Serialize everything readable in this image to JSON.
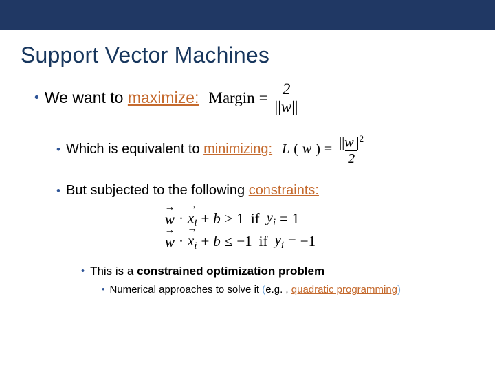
{
  "title": "Support Vector Machines",
  "line1": {
    "pre": "We want to ",
    "kw": "maximize:",
    "post": ""
  },
  "margin_eq": {
    "lhs": "Margin",
    "eq": "=",
    "num": "2",
    "den_l": "||",
    "den_w": "w",
    "den_r": "||"
  },
  "line2": {
    "pre": "Which is equivalent to ",
    "kw": "minimizing:"
  },
  "loss_eq": {
    "L": "L",
    "lp": "(",
    "w": "w",
    "rp": ")",
    "eq": "=",
    "num_l": "||",
    "num_w": "w",
    "num_r": "||",
    "sq": "2",
    "den": "2"
  },
  "line3": {
    "pre": "But subjected to the following ",
    "kw": "constraints:"
  },
  "constraints": [
    {
      "w": "w",
      "dot": "·",
      "xi": "x",
      "sub": "i",
      "plus": "+",
      "b": "b",
      "op": "≥",
      "one": "1",
      "if": "if",
      "yi": "y",
      "ysub": "i",
      "eq": "=",
      "val": "1"
    },
    {
      "w": "w",
      "dot": "·",
      "xi": "x",
      "sub": "i",
      "plus": "+",
      "b": "b",
      "op": "≤",
      "one": "−1",
      "if": "if",
      "yi": "y",
      "ysub": "i",
      "eq": "=",
      "val": "−1"
    }
  ],
  "line4": {
    "pre": "This is a ",
    "bold": "constrained optimization problem"
  },
  "line5": {
    "pre": "Numerical approaches to solve it ",
    "paren_l": "(",
    "eg": "e.g. , ",
    "kw": "quadratic programming",
    "paren_r": ")"
  }
}
